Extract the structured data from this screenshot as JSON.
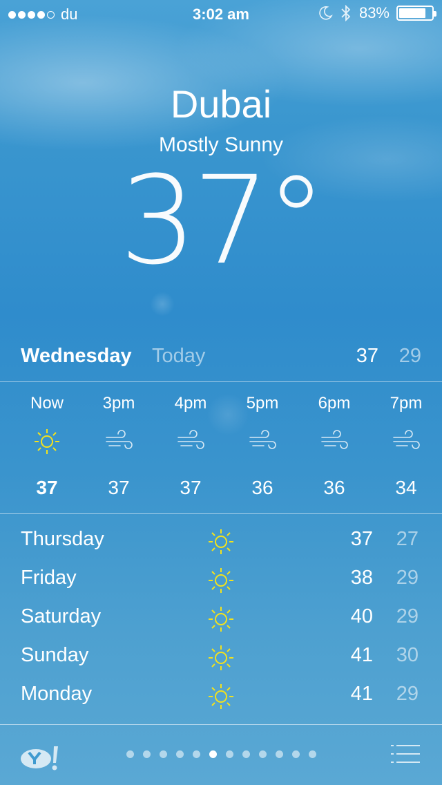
{
  "status": {
    "carrier": "du",
    "signal_filled": 4,
    "signal_total": 5,
    "time": "3:02 am",
    "battery_text": "83%",
    "battery_level": 0.83
  },
  "header": {
    "city": "Dubai",
    "condition": "Mostly Sunny",
    "temperature": "37°"
  },
  "today": {
    "day": "Wednesday",
    "label": "Today",
    "high": "37",
    "low": "29"
  },
  "hourly": [
    {
      "label": "Now",
      "icon": "sun-icon",
      "temp": "37"
    },
    {
      "label": "3pm",
      "icon": "wind-icon",
      "temp": "37"
    },
    {
      "label": "4pm",
      "icon": "wind-icon",
      "temp": "37"
    },
    {
      "label": "5pm",
      "icon": "wind-icon",
      "temp": "36"
    },
    {
      "label": "6pm",
      "icon": "wind-icon",
      "temp": "36"
    },
    {
      "label": "7pm",
      "icon": "wind-icon",
      "temp": "34"
    }
  ],
  "daily": [
    {
      "day": "Thursday",
      "icon": "sun-icon",
      "high": "37",
      "low": "27"
    },
    {
      "day": "Friday",
      "icon": "sun-icon",
      "high": "38",
      "low": "29"
    },
    {
      "day": "Saturday",
      "icon": "sun-icon",
      "high": "40",
      "low": "29"
    },
    {
      "day": "Sunday",
      "icon": "sun-icon",
      "high": "41",
      "low": "30"
    },
    {
      "day": "Monday",
      "icon": "sun-icon",
      "high": "41",
      "low": "29"
    }
  ],
  "footer": {
    "page_count": 12,
    "active_page": 6
  },
  "colors": {
    "sun": "#f3e21c",
    "text": "#ffffff"
  }
}
